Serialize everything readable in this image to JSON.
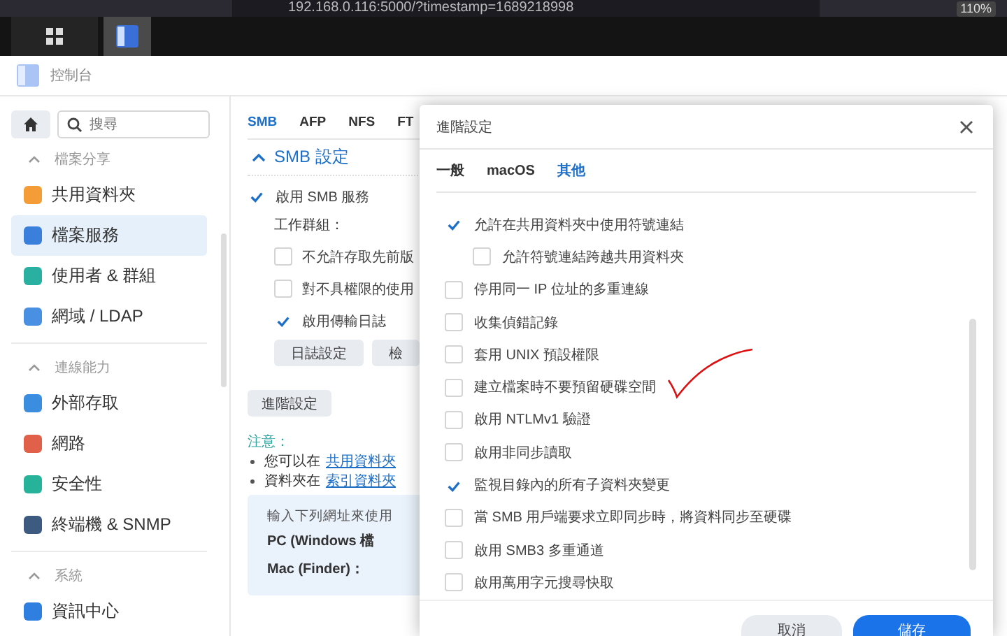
{
  "browser": {
    "url": "192.168.0.116:5000/?timestamp=1689218998",
    "zoom": "110%"
  },
  "app": {
    "title": "控制台"
  },
  "sidebar": {
    "search": {
      "placeholder": "搜尋"
    },
    "sections": [
      {
        "label": "檔案分享",
        "expanded": true,
        "items": [
          {
            "label": "共用資料夾",
            "color": "#f39c38",
            "selected": false
          },
          {
            "label": "檔案服務",
            "color": "#3a7fdc",
            "selected": true
          },
          {
            "label": "使用者 & 群組",
            "color": "#2ab0a0",
            "selected": false
          },
          {
            "label": "網域 / LDAP",
            "color": "#4a90e2",
            "selected": false
          }
        ]
      },
      {
        "label": "連線能力",
        "expanded": true,
        "items": [
          {
            "label": "外部存取",
            "color": "#3b8de0",
            "selected": false
          },
          {
            "label": "網路",
            "color": "#e0604a",
            "selected": false
          },
          {
            "label": "安全性",
            "color": "#27b39a",
            "selected": false
          },
          {
            "label": "終端機 & SNMP",
            "color": "#3d5a80",
            "selected": false
          }
        ]
      },
      {
        "label": "系統",
        "expanded": true,
        "items": [
          {
            "label": "資訊中心",
            "color": "#2f7fe0",
            "selected": false
          }
        ]
      }
    ]
  },
  "main": {
    "tabs": [
      {
        "label": "SMB",
        "selected": true
      },
      {
        "label": "AFP",
        "selected": false
      },
      {
        "label": "NFS",
        "selected": false
      },
      {
        "label": "FT",
        "selected": false
      }
    ],
    "section": {
      "title": "SMB 設定",
      "expanded": true
    },
    "enable": {
      "label": "啟用 SMB 服務",
      "checked": true
    },
    "workgroup_label": "工作群組：",
    "options": [
      {
        "label": "不允許存取先前版",
        "checked": false
      },
      {
        "label": "對不具權限的使用",
        "checked": false
      },
      {
        "label": "啟用傳輸日誌",
        "checked": true
      }
    ],
    "log_buttons": [
      "日誌設定",
      "檢"
    ],
    "advanced_button": "進階設定",
    "note_title": "注意：",
    "notes": [
      {
        "before": "您可以在 ",
        "link": "共用資料夾"
      },
      {
        "before": "資料夾在",
        "link": "索引資料夾"
      }
    ],
    "info_box": {
      "intro": "輸入下列網址來使用",
      "rows": [
        "PC (Windows 檔",
        "Mac (Finder)："
      ]
    }
  },
  "dialog": {
    "title": "進階設定",
    "tabs": [
      {
        "label": "一般",
        "selected": false
      },
      {
        "label": "macOS",
        "selected": false
      },
      {
        "label": "其他",
        "selected": true
      }
    ],
    "options": [
      {
        "label": "允許在共用資料夾中使用符號連結",
        "checked": true,
        "children": [
          {
            "label": "允許符號連結跨越共用資料夾",
            "checked": false
          }
        ]
      },
      {
        "label": "停用同一 IP 位址的多重連線",
        "checked": false
      },
      {
        "label": "收集偵錯記錄",
        "checked": false
      },
      {
        "label": "套用 UNIX 預設權限",
        "checked": false
      },
      {
        "label": "建立檔案時不要預留硬碟空間",
        "checked": false
      },
      {
        "label": "啟用 NTLMv1 驗證",
        "checked": false
      },
      {
        "label": "啟用非同步讀取",
        "checked": false
      },
      {
        "label": "監視目錄內的所有子資料夾變更",
        "checked": true
      },
      {
        "label": "當 SMB 用戶端要求立即同步時，將資料同步至硬碟",
        "checked": false
      },
      {
        "label": "啟用 SMB3 多重通道",
        "checked": false
      },
      {
        "label": "啟用萬用字元搜尋快取",
        "checked": false
      }
    ],
    "buttons": [
      {
        "label": "取消",
        "kind": "secondary"
      },
      {
        "label": "儲存",
        "kind": "primary"
      }
    ]
  }
}
